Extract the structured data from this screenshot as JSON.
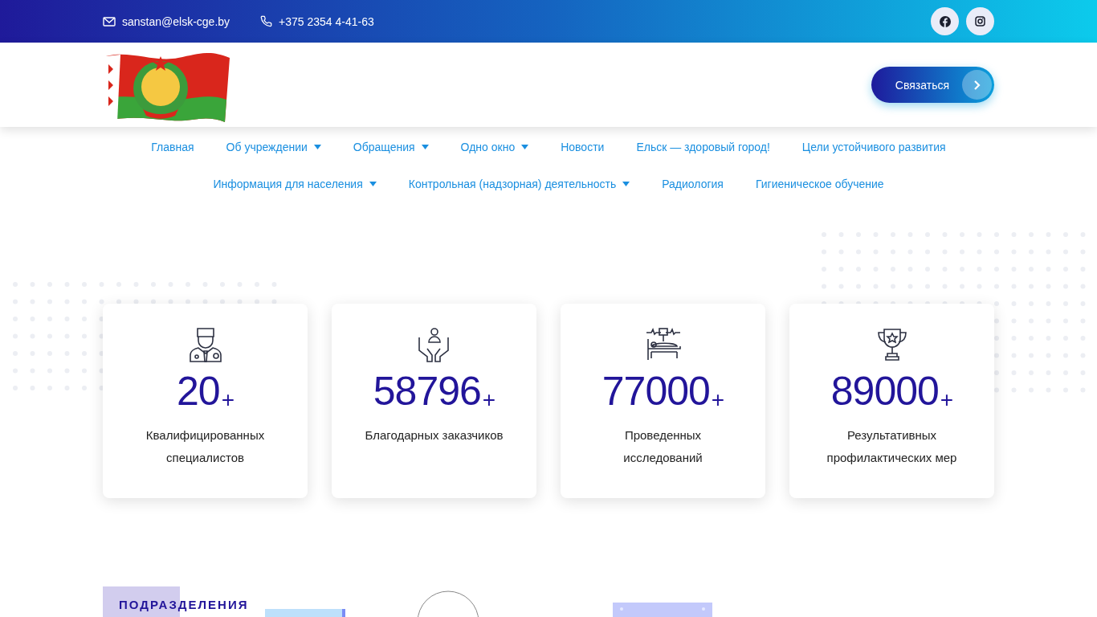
{
  "topbar": {
    "email": "sanstan@elsk-cge.by",
    "phone": "+375 2354 4-41-63"
  },
  "header": {
    "contact_button": "Связаться"
  },
  "nav": [
    [
      {
        "label": "Главная",
        "dropdown": false
      },
      {
        "label": "Об учреждении",
        "dropdown": true
      },
      {
        "label": "Обращения",
        "dropdown": true
      },
      {
        "label": "Одно окно",
        "dropdown": true
      },
      {
        "label": "Новости",
        "dropdown": false
      },
      {
        "label": "Ельск — здоровый город!",
        "dropdown": false
      },
      {
        "label": "Цели устойчивого развития",
        "dropdown": false
      }
    ],
    [
      {
        "label": "Информация для населения",
        "dropdown": true
      },
      {
        "label": "Контрольная (надзорная) деятельность",
        "dropdown": true
      },
      {
        "label": "Радиология",
        "dropdown": false
      },
      {
        "label": "Гигиеническое обучение",
        "dropdown": false
      }
    ]
  ],
  "stats": [
    {
      "kind": "doctor",
      "value": "20",
      "suffix": "+",
      "label": "Квалифицированных специалистов"
    },
    {
      "kind": "hands",
      "value": "58796",
      "suffix": "+",
      "label": "Благодарных заказчиков"
    },
    {
      "kind": "patient",
      "value": "77000",
      "suffix": "+",
      "label": "Проведенных исследований"
    },
    {
      "kind": "trophy",
      "value": "89000",
      "suffix": "+",
      "label": "Результативных профилактических мер"
    }
  ],
  "section": {
    "label": "ПОДРАЗДЕЛЕНИЯ"
  }
}
